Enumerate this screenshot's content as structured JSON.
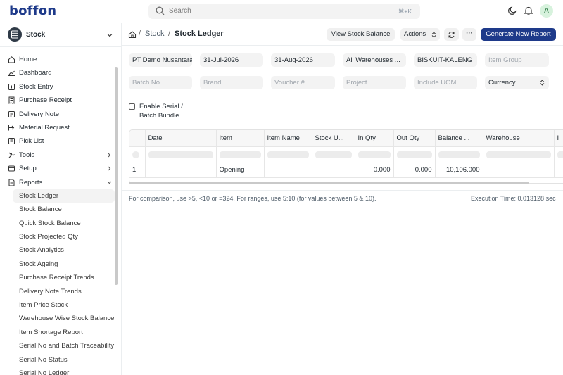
{
  "app": {
    "logo": "boffon",
    "avatar_initial": "A"
  },
  "search": {
    "placeholder": "Search",
    "shortcut": "⌘+K"
  },
  "workspace": {
    "label": "Stock"
  },
  "sidebar": {
    "items": [
      {
        "label": "Home",
        "icon": "home-icon"
      },
      {
        "label": "Dashboard",
        "icon": "dashboard-icon"
      },
      {
        "label": "Stock Entry",
        "icon": "stock-entry-icon"
      },
      {
        "label": "Purchase Receipt",
        "icon": "receipt-icon"
      },
      {
        "label": "Delivery Note",
        "icon": "delivery-icon"
      },
      {
        "label": "Material Request",
        "icon": "material-request-icon"
      },
      {
        "label": "Pick List",
        "icon": "list-icon"
      },
      {
        "label": "Tools",
        "icon": "tools-icon"
      },
      {
        "label": "Setup",
        "icon": "setup-icon"
      },
      {
        "label": "Reports",
        "icon": "reports-icon"
      }
    ],
    "reports": [
      "Stock Ledger",
      "Stock Balance",
      "Quick Stock Balance",
      "Stock Projected Qty",
      "Stock Analytics",
      "Stock Ageing",
      "Purchase Receipt Trends",
      "Delivery Note Trends",
      "Item Price Stock",
      "Warehouse Wise Stock Balance",
      "Item Shortage Report",
      "Serial No and Batch Traceability",
      "Serial No Status",
      "Serial No Ledger"
    ]
  },
  "breadcrumb": {
    "sep": "/",
    "parent": "Stock",
    "current": "Stock Ledger"
  },
  "actions": {
    "view_balance": "View Stock Balance",
    "actions": "Actions",
    "more": "···",
    "generate": "Generate New Report"
  },
  "filters": {
    "company": "PT Demo Nusantara",
    "from_date": "31-Jul-2026",
    "to_date": "31-Aug-2026",
    "warehouse": "All Warehouses ...",
    "item": "BISKUIT-KALENG",
    "item_group": "Item Group",
    "batch_no": "Batch No",
    "brand": "Brand",
    "voucher": "Voucher #",
    "project": "Project",
    "include_uom": "Include UOM",
    "currency": "Currency",
    "serial_label": "Enable Serial / Batch Bundle"
  },
  "table": {
    "columns": [
      "Date",
      "Item",
      "Item Name",
      "Stock U...",
      "In Qty",
      "Out Qty",
      "Balance ...",
      "Warehouse",
      "I"
    ],
    "rows": [
      {
        "index": "1",
        "date": "",
        "item": "Opening",
        "item_name": "",
        "uom": "",
        "in_qty": "0.000",
        "out_qty": "0.000",
        "balance": "10,106.000",
        "warehouse": ""
      }
    ]
  },
  "footer": {
    "hint": "For comparison, use >5, <10 or =324. For ranges, use 5:10 (for values between 5 & 10).",
    "execution": "Execution Time: 0.013128 sec"
  },
  "colors": {
    "primary": "#1e3a8a",
    "avatar_bg": "#d7f2dd"
  }
}
